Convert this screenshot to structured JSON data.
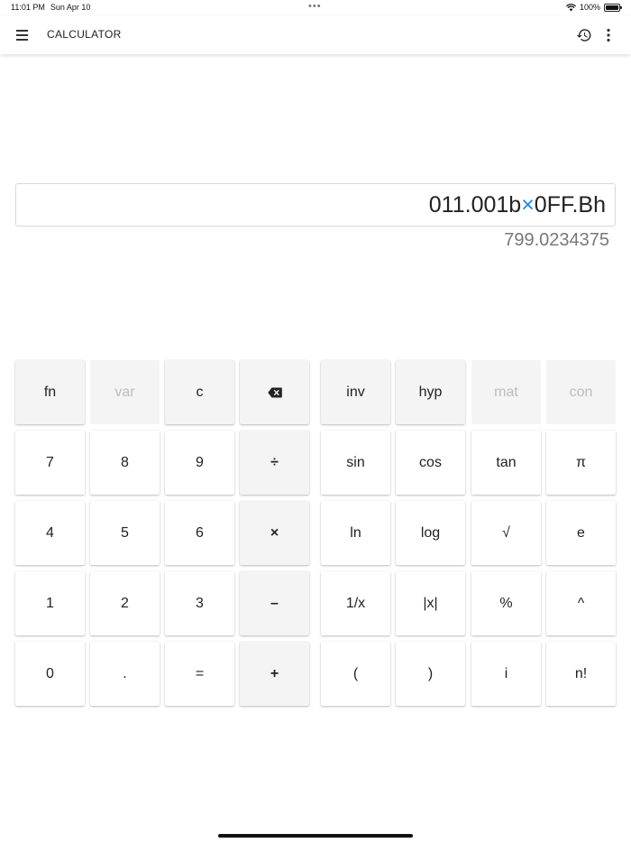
{
  "status_bar": {
    "time": "11:01 PM",
    "date": "Sun Apr 10",
    "battery": "100%",
    "dots": "•••"
  },
  "app_bar": {
    "title": "CALCULATOR"
  },
  "display": {
    "expression_left": "011.001b",
    "expression_operator": "×",
    "expression_right": "0FF.Bh",
    "result": "799.0234375",
    "operator_color": "#1e88e5"
  },
  "keypad": {
    "row1": {
      "fn": "fn",
      "var": "var",
      "c": "c",
      "backspace": "⌫",
      "inv": "inv",
      "hyp": "hyp",
      "mat": "mat",
      "con": "con"
    },
    "row2": {
      "k7": "7",
      "k8": "8",
      "k9": "9",
      "divide": "÷",
      "sin": "sin",
      "cos": "cos",
      "tan": "tan",
      "pi": "π"
    },
    "row3": {
      "k4": "4",
      "k5": "5",
      "k6": "6",
      "multiply": "×",
      "ln": "ln",
      "log": "log",
      "sqrt": "√",
      "e": "e"
    },
    "row4": {
      "k1": "1",
      "k2": "2",
      "k3": "3",
      "minus": "–",
      "reciprocal": "1/x",
      "abs": "|x|",
      "percent": "%",
      "power": "^"
    },
    "row5": {
      "k0": "0",
      "dot": ".",
      "equals": "=",
      "plus": "+",
      "lparen": "(",
      "rparen": ")",
      "imag": "i",
      "factorial": "n!"
    }
  }
}
